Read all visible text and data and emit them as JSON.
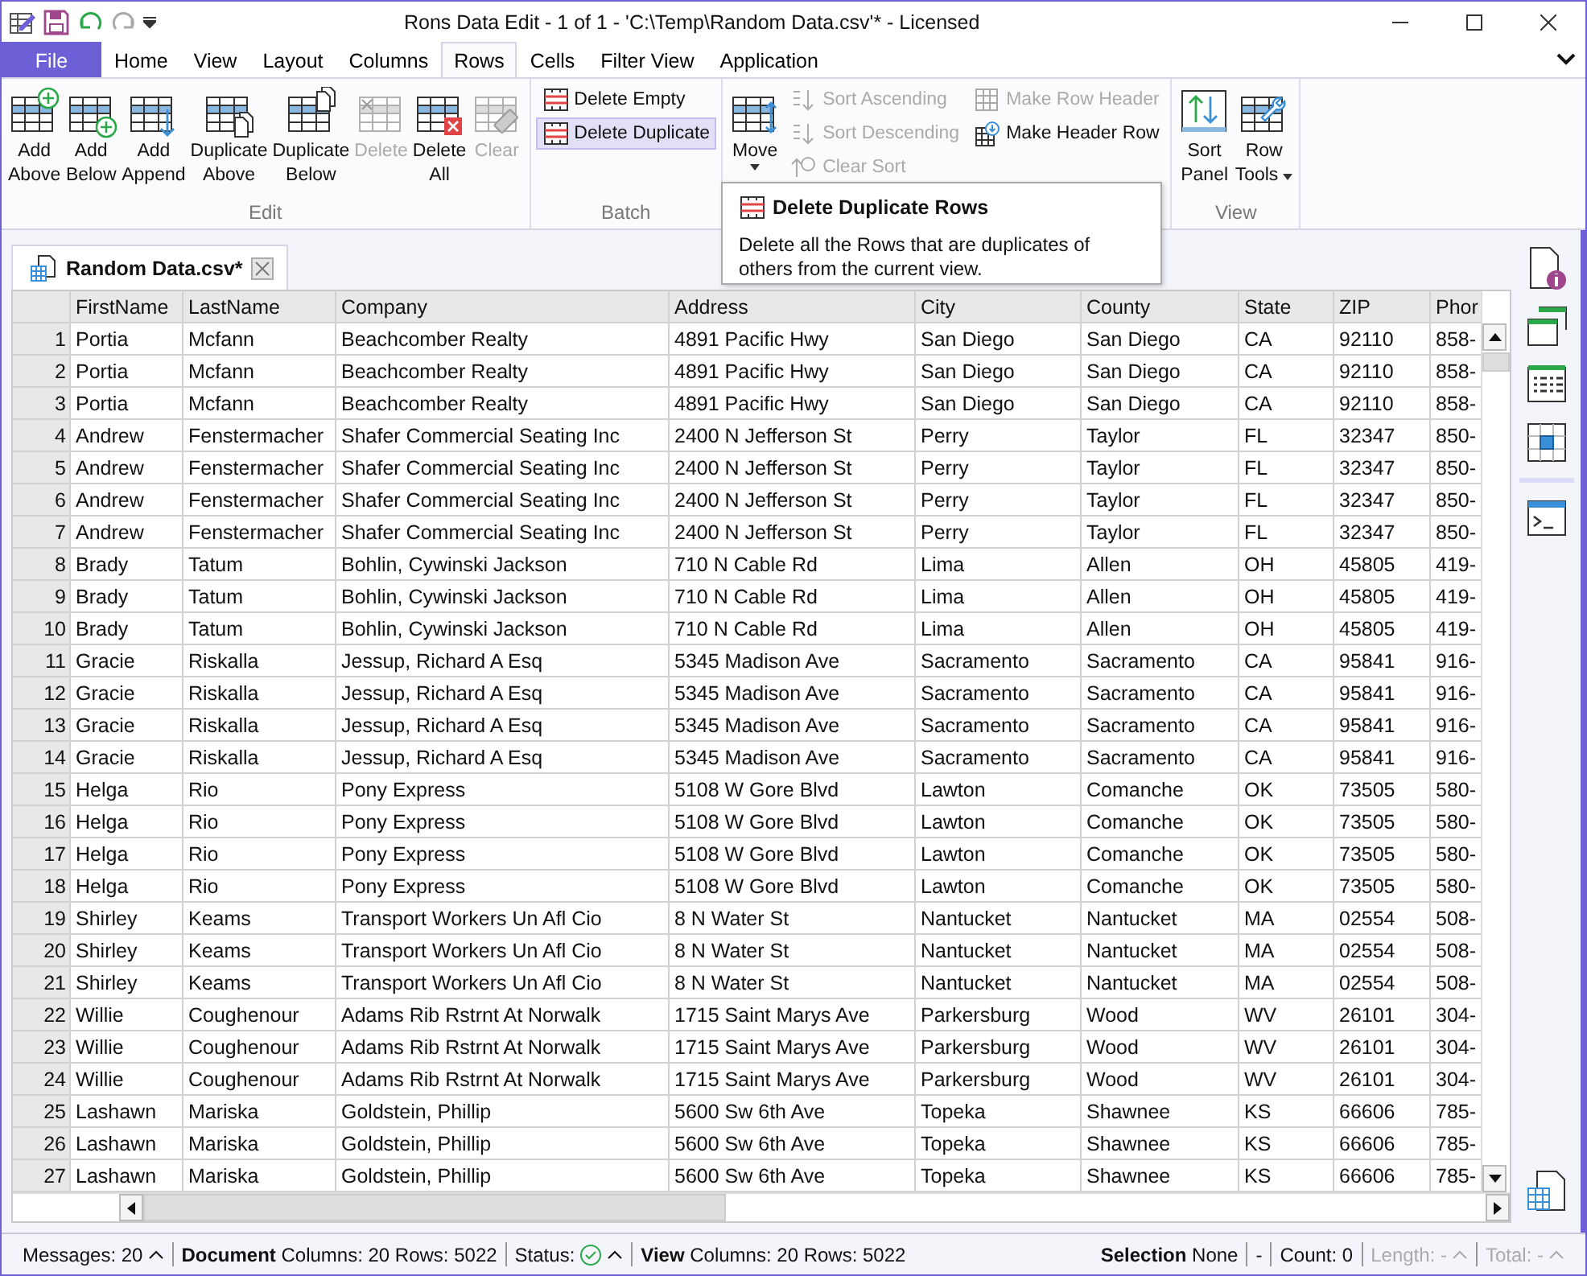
{
  "window": {
    "title": "Rons Data Edit - 1 of 1 - 'C:\\Temp\\Random Data.csv'* - Licensed"
  },
  "tabs": [
    {
      "label": "File",
      "kind": "file",
      "selected": false
    },
    {
      "label": "Home",
      "kind": "tab",
      "selected": false
    },
    {
      "label": "View",
      "kind": "tab",
      "selected": false
    },
    {
      "label": "Layout",
      "kind": "tab",
      "selected": false
    },
    {
      "label": "Columns",
      "kind": "tab",
      "selected": false
    },
    {
      "label": "Rows",
      "kind": "tab",
      "selected": true
    },
    {
      "label": "Cells",
      "kind": "tab",
      "selected": false
    },
    {
      "label": "Filter View",
      "kind": "tab",
      "selected": false
    },
    {
      "label": "Application",
      "kind": "tab",
      "selected": false
    }
  ],
  "ribbon": {
    "groups": [
      {
        "label": "Edit",
        "kind": "large",
        "buttons": [
          {
            "label": [
              "Add",
              "Above"
            ],
            "disabled": false,
            "dropdown": false
          },
          {
            "label": [
              "Add",
              "Below"
            ],
            "disabled": false,
            "dropdown": false
          },
          {
            "label": [
              "Add",
              "Append"
            ],
            "disabled": false,
            "dropdown": false
          },
          {
            "label": [
              "Duplicate",
              "Above"
            ],
            "disabled": false,
            "dropdown": false
          },
          {
            "label": [
              "Duplicate",
              "Below"
            ],
            "disabled": false,
            "dropdown": false
          },
          {
            "label": [
              "Delete"
            ],
            "disabled": true,
            "dropdown": false
          },
          {
            "label": [
              "Delete",
              "All"
            ],
            "disabled": false,
            "dropdown": false
          },
          {
            "label": [
              "Clear"
            ],
            "disabled": true,
            "dropdown": false
          }
        ]
      },
      {
        "label": "Batch",
        "kind": "small",
        "buttons": [
          {
            "label": "Delete Empty",
            "disabled": false,
            "highlighted": false
          },
          {
            "label": "Delete Duplicate",
            "disabled": false,
            "highlighted": true
          }
        ]
      },
      {
        "kind": "mixed",
        "large": {
          "label": [
            "Move"
          ],
          "disabled": false,
          "dropdown": true
        },
        "columns": [
          [
            {
              "label": "Sort Ascending",
              "disabled": true,
              "highlighted": false
            },
            {
              "label": "Sort Descending",
              "disabled": true,
              "highlighted": false
            },
            {
              "label": "Clear Sort",
              "disabled": true,
              "highlighted": false
            }
          ],
          [
            {
              "label": "Make Row Header",
              "disabled": true,
              "highlighted": false
            },
            {
              "label": "Make Header Row",
              "disabled": false,
              "highlighted": false
            }
          ]
        ]
      },
      {
        "label": "View",
        "kind": "large",
        "buttons": [
          {
            "label": [
              "Sort",
              "Panel"
            ],
            "disabled": false,
            "dropdown": false
          },
          {
            "label": [
              "Row",
              "Tools"
            ],
            "disabled": false,
            "dropdown": true
          }
        ]
      }
    ]
  },
  "tooltip": {
    "title": "Delete Duplicate Rows",
    "body": "Delete all the Rows that are duplicates of others from the current view."
  },
  "document_tab": {
    "label": "Random Data.csv*",
    "selected": true
  },
  "table": {
    "columns": [
      "FirstName",
      "LastName",
      "Company",
      "Address",
      "City",
      "County",
      "State",
      "ZIP",
      "Phor"
    ],
    "rows": [
      {
        "number": "1",
        "cells": [
          "Portia",
          "Mcfann",
          "Beachcomber Realty",
          "4891 Pacific Hwy",
          "San Diego",
          "San Diego",
          "CA",
          "92110",
          "858-"
        ]
      },
      {
        "number": "2",
        "cells": [
          "Portia",
          "Mcfann",
          "Beachcomber Realty",
          "4891 Pacific Hwy",
          "San Diego",
          "San Diego",
          "CA",
          "92110",
          "858-"
        ]
      },
      {
        "number": "3",
        "cells": [
          "Portia",
          "Mcfann",
          "Beachcomber Realty",
          "4891 Pacific Hwy",
          "San Diego",
          "San Diego",
          "CA",
          "92110",
          "858-"
        ]
      },
      {
        "number": "4",
        "cells": [
          "Andrew",
          "Fenstermacher",
          "Shafer Commercial Seating Inc",
          "2400 N Jefferson St",
          "Perry",
          "Taylor",
          "FL",
          "32347",
          "850-"
        ]
      },
      {
        "number": "5",
        "cells": [
          "Andrew",
          "Fenstermacher",
          "Shafer Commercial Seating Inc",
          "2400 N Jefferson St",
          "Perry",
          "Taylor",
          "FL",
          "32347",
          "850-"
        ]
      },
      {
        "number": "6",
        "cells": [
          "Andrew",
          "Fenstermacher",
          "Shafer Commercial Seating Inc",
          "2400 N Jefferson St",
          "Perry",
          "Taylor",
          "FL",
          "32347",
          "850-"
        ]
      },
      {
        "number": "7",
        "cells": [
          "Andrew",
          "Fenstermacher",
          "Shafer Commercial Seating Inc",
          "2400 N Jefferson St",
          "Perry",
          "Taylor",
          "FL",
          "32347",
          "850-"
        ]
      },
      {
        "number": "8",
        "cells": [
          "Brady",
          "Tatum",
          "Bohlin, Cywinski Jackson",
          "710 N Cable Rd",
          "Lima",
          "Allen",
          "OH",
          "45805",
          "419-"
        ]
      },
      {
        "number": "9",
        "cells": [
          "Brady",
          "Tatum",
          "Bohlin, Cywinski Jackson",
          "710 N Cable Rd",
          "Lima",
          "Allen",
          "OH",
          "45805",
          "419-"
        ]
      },
      {
        "number": "10",
        "cells": [
          "Brady",
          "Tatum",
          "Bohlin, Cywinski Jackson",
          "710 N Cable Rd",
          "Lima",
          "Allen",
          "OH",
          "45805",
          "419-"
        ]
      },
      {
        "number": "11",
        "cells": [
          "Gracie",
          "Riskalla",
          "Jessup, Richard A Esq",
          "5345 Madison Ave",
          "Sacramento",
          "Sacramento",
          "CA",
          "95841",
          "916-"
        ]
      },
      {
        "number": "12",
        "cells": [
          "Gracie",
          "Riskalla",
          "Jessup, Richard A Esq",
          "5345 Madison Ave",
          "Sacramento",
          "Sacramento",
          "CA",
          "95841",
          "916-"
        ]
      },
      {
        "number": "13",
        "cells": [
          "Gracie",
          "Riskalla",
          "Jessup, Richard A Esq",
          "5345 Madison Ave",
          "Sacramento",
          "Sacramento",
          "CA",
          "95841",
          "916-"
        ]
      },
      {
        "number": "14",
        "cells": [
          "Gracie",
          "Riskalla",
          "Jessup, Richard A Esq",
          "5345 Madison Ave",
          "Sacramento",
          "Sacramento",
          "CA",
          "95841",
          "916-"
        ]
      },
      {
        "number": "15",
        "cells": [
          "Helga",
          "Rio",
          "Pony Express",
          "5108 W Gore Blvd",
          "Lawton",
          "Comanche",
          "OK",
          "73505",
          "580-"
        ]
      },
      {
        "number": "16",
        "cells": [
          "Helga",
          "Rio",
          "Pony Express",
          "5108 W Gore Blvd",
          "Lawton",
          "Comanche",
          "OK",
          "73505",
          "580-"
        ]
      },
      {
        "number": "17",
        "cells": [
          "Helga",
          "Rio",
          "Pony Express",
          "5108 W Gore Blvd",
          "Lawton",
          "Comanche",
          "OK",
          "73505",
          "580-"
        ]
      },
      {
        "number": "18",
        "cells": [
          "Helga",
          "Rio",
          "Pony Express",
          "5108 W Gore Blvd",
          "Lawton",
          "Comanche",
          "OK",
          "73505",
          "580-"
        ]
      },
      {
        "number": "19",
        "cells": [
          "Shirley",
          "Keams",
          "Transport Workers Un Afl Cio",
          "8 N Water St",
          "Nantucket",
          "Nantucket",
          "MA",
          "02554",
          "508-"
        ]
      },
      {
        "number": "20",
        "cells": [
          "Shirley",
          "Keams",
          "Transport Workers Un Afl Cio",
          "8 N Water St",
          "Nantucket",
          "Nantucket",
          "MA",
          "02554",
          "508-"
        ]
      },
      {
        "number": "21",
        "cells": [
          "Shirley",
          "Keams",
          "Transport Workers Un Afl Cio",
          "8 N Water St",
          "Nantucket",
          "Nantucket",
          "MA",
          "02554",
          "508-"
        ]
      },
      {
        "number": "22",
        "cells": [
          "Willie",
          "Coughenour",
          "Adams Rib Rstrnt At Norwalk",
          "1715 Saint Marys Ave",
          "Parkersburg",
          "Wood",
          "WV",
          "26101",
          "304-"
        ]
      },
      {
        "number": "23",
        "cells": [
          "Willie",
          "Coughenour",
          "Adams Rib Rstrnt At Norwalk",
          "1715 Saint Marys Ave",
          "Parkersburg",
          "Wood",
          "WV",
          "26101",
          "304-"
        ]
      },
      {
        "number": "24",
        "cells": [
          "Willie",
          "Coughenour",
          "Adams Rib Rstrnt At Norwalk",
          "1715 Saint Marys Ave",
          "Parkersburg",
          "Wood",
          "WV",
          "26101",
          "304-"
        ]
      },
      {
        "number": "25",
        "cells": [
          "Lashawn",
          "Mariska",
          "Goldstein, Phillip",
          "5600 Sw 6th Ave",
          "Topeka",
          "Shawnee",
          "KS",
          "66606",
          "785-"
        ]
      },
      {
        "number": "26",
        "cells": [
          "Lashawn",
          "Mariska",
          "Goldstein, Phillip",
          "5600 Sw 6th Ave",
          "Topeka",
          "Shawnee",
          "KS",
          "66606",
          "785-"
        ]
      },
      {
        "number": "27",
        "cells": [
          "Lashawn",
          "Mariska",
          "Goldstein, Phillip",
          "5600 Sw 6th Ave",
          "Topeka",
          "Shawnee",
          "KS",
          "66606",
          "785-"
        ]
      }
    ]
  },
  "status_bar": {
    "left": [
      {
        "text": "Messages: 20",
        "kind": "menu",
        "disabled": false
      },
      {
        "text": "**Document** Columns: 20 Rows: 5022",
        "kind": "text",
        "disabled": false
      },
      {
        "text": "Status:",
        "kind": "status",
        "disabled": false
      },
      {
        "text": "**View** Columns: 20 Rows: 5022",
        "kind": "text",
        "disabled": false
      }
    ],
    "right": [
      {
        "text": "**Selection** None",
        "kind": "text",
        "disabled": false
      },
      {
        "text": "-",
        "kind": "text",
        "disabled": false
      },
      {
        "text": "Count: 0",
        "kind": "text",
        "disabled": false
      },
      {
        "text": "Length: -",
        "kind": "menu",
        "disabled": true
      },
      {
        "text": "Total: -",
        "kind": "menu",
        "disabled": true
      }
    ]
  }
}
